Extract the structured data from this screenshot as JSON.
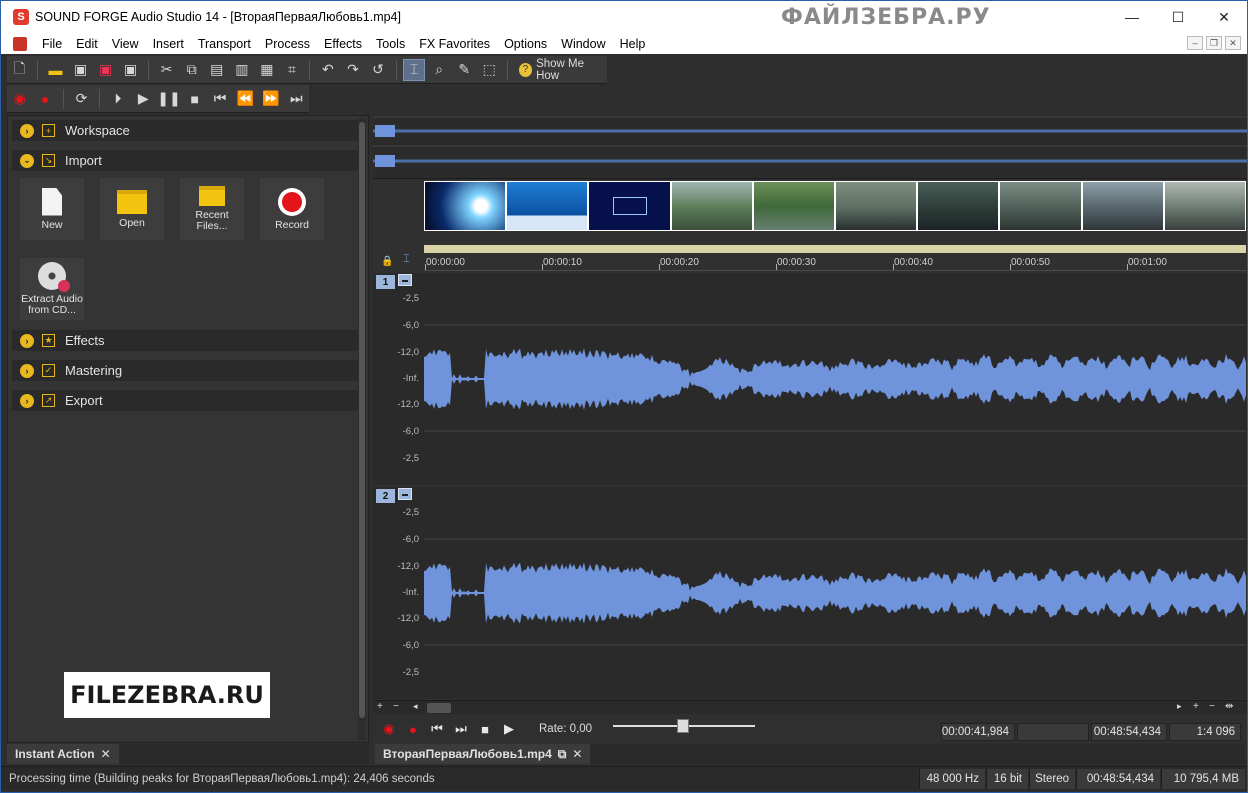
{
  "window": {
    "title": "SOUND FORGE Audio Studio 14 - [ВтораяПерваяЛюбовь1.mp4]",
    "app_icon": "S",
    "watermark_top": "ФАЙЛЗЕБРА.РУ",
    "minimize": "—",
    "maximize": "☐",
    "close": "✕"
  },
  "menu": {
    "items": [
      "File",
      "Edit",
      "View",
      "Insert",
      "Transport",
      "Process",
      "Effects",
      "Tools",
      "FX Favorites",
      "Options",
      "Window",
      "Help"
    ]
  },
  "toolbar": {
    "show_me_how": "Show Me How"
  },
  "panel": {
    "sections": [
      {
        "label": "Workspace",
        "state": "collapsed"
      },
      {
        "label": "Import",
        "state": "expanded"
      },
      {
        "label": "Effects",
        "state": "collapsed"
      },
      {
        "label": "Mastering",
        "state": "collapsed"
      },
      {
        "label": "Export",
        "state": "collapsed"
      }
    ],
    "tiles": [
      "New",
      "Open",
      "Recent Files...",
      "Record",
      "Extract Audio from CD..."
    ],
    "watermark_bottom": "FILEZEBRA.RU"
  },
  "tabs": {
    "left": "Instant Action",
    "doc": "ВтораяПерваяЛюбовь1.mp4"
  },
  "ruler": {
    "labels": [
      "00:00:00",
      "00:00:10",
      "00:00:20",
      "00:00:30",
      "00:00:40",
      "00:00:50",
      "00:01:00"
    ]
  },
  "tracks": [
    {
      "number": "1",
      "db": [
        "-2,5",
        "-6,0",
        "-12,0",
        "-Inf.",
        "-12,0",
        "-6,0",
        "-2,5"
      ]
    },
    {
      "number": "2",
      "db": [
        "-2,5",
        "-6,0",
        "-12,0",
        "-Inf.",
        "-12,0",
        "-6,0",
        "-2,5"
      ]
    }
  ],
  "transport": {
    "rate": "Rate: 0,00",
    "cursor": "00:00:41,984",
    "selection": "",
    "length": "00:48:54,434",
    "zoom": "1:4 096"
  },
  "status": {
    "message": "Processing time (Building peaks for ВтораяПерваяЛюбовь1.mp4): 24,406 seconds",
    "sample_rate": "48 000 Hz",
    "bit_depth": "16 bit",
    "channels": "Stereo",
    "duration": "00:48:54,434",
    "size": "10 795,4 MB"
  },
  "colors": {
    "waveform": "#6f94dc",
    "accent": "#e8b81f",
    "record": "#e4141b"
  }
}
